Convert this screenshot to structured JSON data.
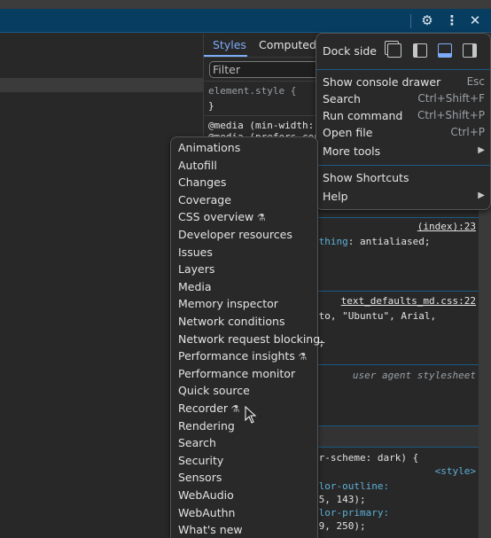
{
  "toolbar": {
    "icons": [
      "gear-icon",
      "more-vertical-icon",
      "close-icon"
    ]
  },
  "styles": {
    "tabs": [
      "Styles",
      "Computed"
    ],
    "filter_placeholder": "Filter",
    "lines": {
      "element_style": "element.style {",
      "close_brace": "}",
      "media": "@media (min-width:",
      "media_cont": "@media (prefers-contrast)",
      "index_link": "(index):23",
      "smoothing_prop": "othing",
      "smoothing_val": ": antialiased;",
      "text_defaults_link": "text_defaults_md.css:22",
      "font_line": "oto, \"Ubuntu\", Arial,",
      "strike": "%;",
      "ua": "user agent stylesheet",
      "inherited": "d",
      "scheme": "or-scheme: dark) {",
      "style_tag": "<style>",
      "outline_prop": "olor-outline:",
      "outline_val": "45, 143);",
      "primary_prop": "olor-primary:",
      "primary_val": "99, 250);"
    }
  },
  "dock_menu": {
    "dock_side_label": "Dock side",
    "dock_options": [
      "undock",
      "dock-left",
      "dock-bottom",
      "dock-right"
    ],
    "selected_dock": "dock-bottom",
    "items": [
      {
        "label": "Show console drawer",
        "shortcut": "Esc"
      },
      {
        "label": "Search",
        "shortcut": "Ctrl+Shift+F"
      },
      {
        "label": "Run command",
        "shortcut": "Ctrl+Shift+P"
      },
      {
        "label": "Open file",
        "shortcut": "Ctrl+P"
      },
      {
        "label": "More tools",
        "submenu": true
      }
    ],
    "items2": [
      {
        "label": "Show Shortcuts"
      },
      {
        "label": "Help",
        "submenu": true
      }
    ]
  },
  "more_tools": [
    {
      "label": "Animations"
    },
    {
      "label": "Autofill"
    },
    {
      "label": "Changes"
    },
    {
      "label": "Coverage"
    },
    {
      "label": "CSS overview",
      "experimental": true
    },
    {
      "label": "Developer resources"
    },
    {
      "label": "Issues"
    },
    {
      "label": "Layers"
    },
    {
      "label": "Media"
    },
    {
      "label": "Memory inspector"
    },
    {
      "label": "Network conditions"
    },
    {
      "label": "Network request blocking"
    },
    {
      "label": "Performance insights",
      "experimental": true
    },
    {
      "label": "Performance monitor"
    },
    {
      "label": "Quick source"
    },
    {
      "label": "Recorder",
      "experimental": true
    },
    {
      "label": "Rendering"
    },
    {
      "label": "Search"
    },
    {
      "label": "Security"
    },
    {
      "label": "Sensors"
    },
    {
      "label": "WebAudio"
    },
    {
      "label": "WebAuthn"
    },
    {
      "label": "What's new"
    }
  ],
  "colors": {
    "accent": "#7cacf8",
    "toolbar": "#063d61",
    "menu_bg": "#292929"
  }
}
